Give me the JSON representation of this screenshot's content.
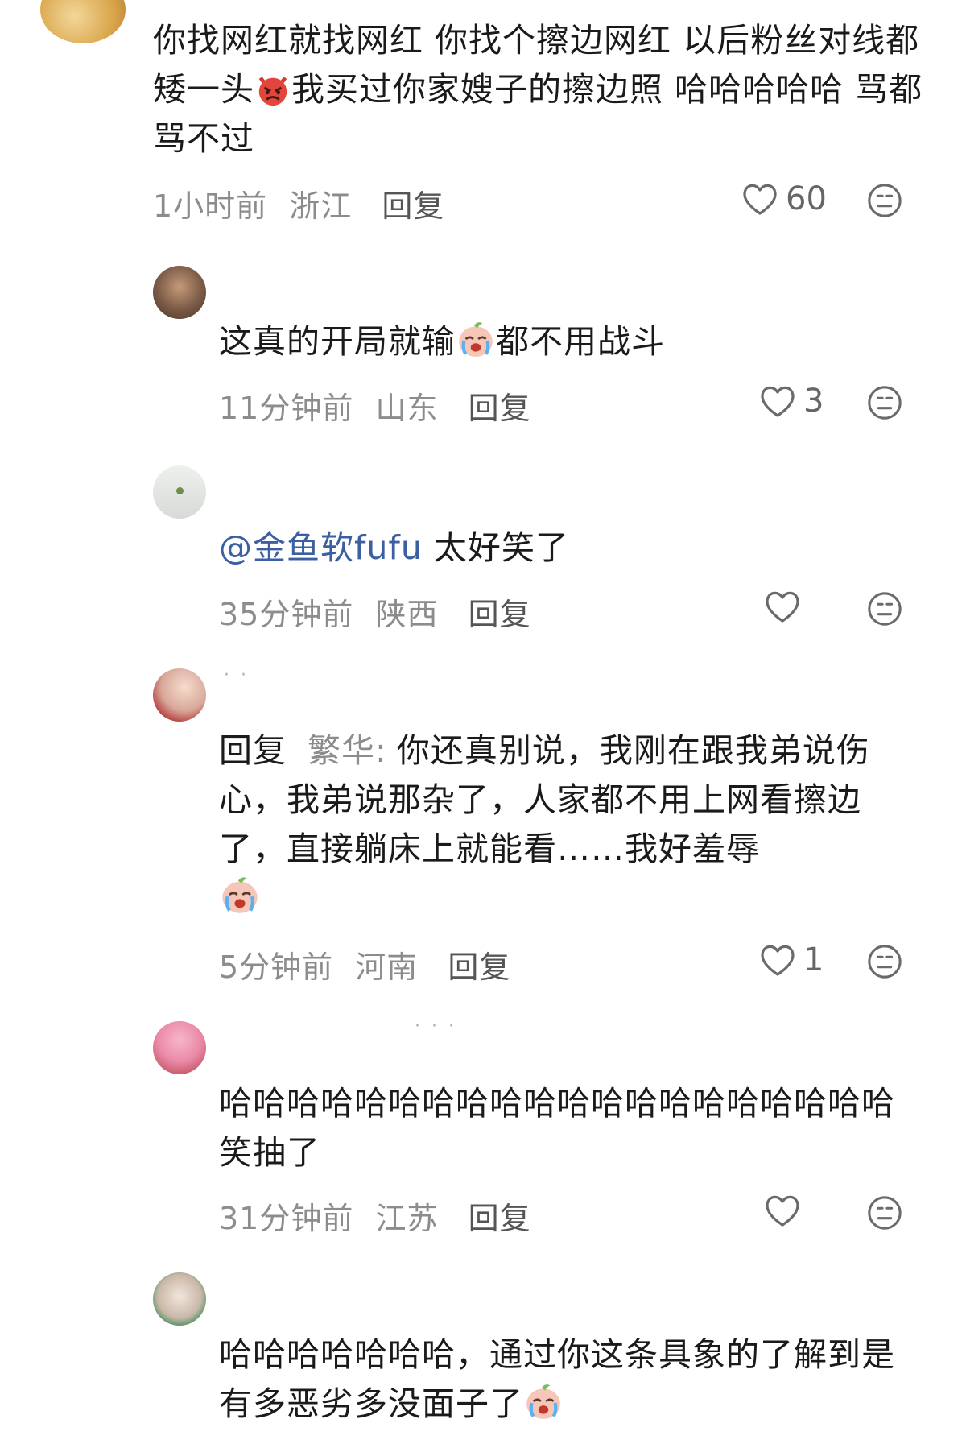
{
  "comments": [
    {
      "text_before_emoji": "你找网红就找网红 你找个擦边网红 以后粉丝对线都矮一头",
      "text_after_emoji": "我买过你家嫂子的擦边照 哈哈哈哈哈 骂都骂不过",
      "emoji_icon": "angry-devil-emoji-icon",
      "time": "1小时前",
      "location": "浙江",
      "reply_label": "回复",
      "likes": "60"
    },
    {
      "text_before_emoji": "这真的开局就输",
      "emoji_icon": "crying-face-emoji-icon",
      "text_after_emoji": "都不用战斗",
      "time": "11分钟前",
      "location": "山东",
      "reply_label": "回复",
      "likes": "3"
    },
    {
      "mention": "@金鱼软fufu",
      "text": " 太好笑了",
      "time": "35分钟前",
      "location": "陕西",
      "reply_label": "回复",
      "likes": ""
    },
    {
      "reply_prefix": "回复",
      "reply_to": "繁华:",
      "text": "你还真别说，我刚在跟我弟说伤心，我弟说那杂了，人家都不用上网看擦边了，直接躺床上就能看……我好羞辱",
      "emoji_icon": "crying-face-emoji-icon",
      "time": "5分钟前",
      "location": "河南",
      "reply_label": "回复",
      "likes": "1"
    },
    {
      "text": "哈哈哈哈哈哈哈哈哈哈哈哈哈哈哈哈哈哈哈哈 笑抽了",
      "time": "31分钟前",
      "location": "江苏",
      "reply_label": "回复",
      "likes": ""
    },
    {
      "text_before_emoji": "哈哈哈哈哈哈哈，通过你这条具象的了解到是有多恶劣多没面子了",
      "emoji_icon": "crying-face-emoji-icon"
    }
  ],
  "icons": {
    "like": "heart-outline-icon",
    "dislike": "neutral-face-icon"
  },
  "colors": {
    "text": "#1a1a1a",
    "meta": "#8c8c8c",
    "mention": "#3b5fa0"
  }
}
